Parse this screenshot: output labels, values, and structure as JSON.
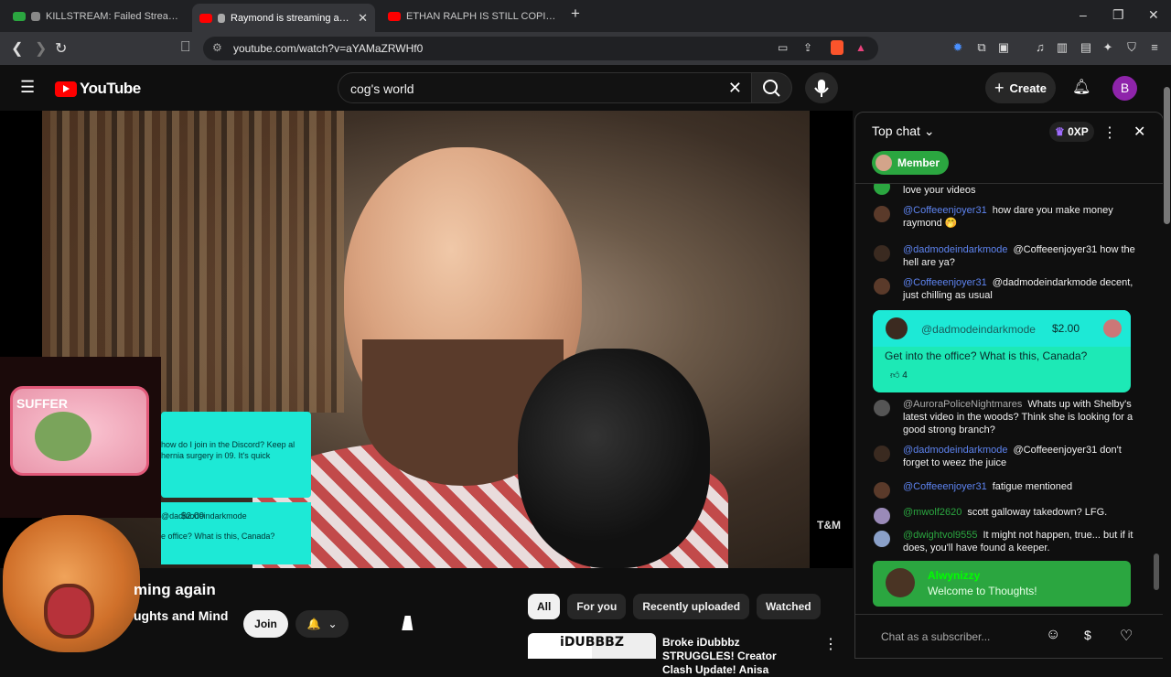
{
  "browser": {
    "tabs": [
      {
        "title": "KILLSTREAM: Failed Streamer Kyle"
      },
      {
        "title": "Raymond is streaming again"
      },
      {
        "title": "ETHAN RALPH IS STILL COPING, STILL"
      }
    ],
    "new_tab": "+",
    "url": "youtube.com/watch?v=aYAMaZRWHf0",
    "window_controls": {
      "minimize": "–",
      "maximize": "❐",
      "close": "✕"
    }
  },
  "youtube": {
    "logo_text": "YouTube",
    "search_query": "cog's world",
    "clear_icon": "✕",
    "create_label": "Create",
    "avatar_letter": "B"
  },
  "player": {
    "overlay_card_1": "how do I join in the Discord? Keep  al hernia surgery in 09. It's quick",
    "overlay_card_2_name": "@dadmodeindarkmode",
    "overlay_card_2_amount": "$2.00",
    "overlay_card_2_text": "e office? What is this, Canada?",
    "suffer_text": "SUFFER",
    "watermark": "T&M"
  },
  "video": {
    "title": "ming again",
    "channel": "ughts and Mind",
    "join_label": "Join",
    "bell_icon": "🔔",
    "dropdown_icon": "⌄"
  },
  "recommendations": {
    "chips": [
      "All",
      "For you",
      "Recently uploaded",
      "Watched"
    ],
    "selected_chip": "All",
    "first_thumb_text": "iDUBBBZ",
    "first_title": "Broke iDubbbz STRUGGLES! Creator Clash Update! Anisa",
    "more_icon": "⋮"
  },
  "chat": {
    "header": "Top chat",
    "xp": "0XP",
    "member_label": "Member",
    "messages": [
      {
        "author": "",
        "text": "love your videos"
      },
      {
        "author": "@Coffeeenjoyer31",
        "text": "how dare you make money raymond 🤭"
      },
      {
        "author": "@dadmodeindarkmode",
        "text": "@Coffeeenjoyer31 how the hell are ya?"
      },
      {
        "author": "@Coffeeenjoyer31",
        "text": "@dadmodeindarkmode decent, just chilling as usual"
      },
      {
        "author": "@AuroraPoliceNightmares",
        "text": "Whats up with Shelby's latest video in the woods? Think she is looking for a good strong branch?"
      },
      {
        "author": "@dadmodeindarkmode",
        "text": "@Coffeeenjoyer31 don't forget to weez the juice"
      },
      {
        "author": "@Coffeeenjoyer31",
        "text": "fatigue mentioned"
      },
      {
        "author": "@mwolf2620",
        "text": "scott galloway takedown? LFG."
      },
      {
        "author": "@dwightvol9555",
        "text": "It might not happen, true... but if it does, you'll have found a keeper."
      }
    ],
    "superchat": {
      "author": "@dadmodeindarkmode",
      "amount": "$2.00",
      "text": "Get into the office? What is this, Canada?",
      "likes": "4"
    },
    "welcome": {
      "name": "Alwynizzy",
      "text": "Welcome to Thoughts!"
    },
    "input_placeholder": "Chat as a subscriber...",
    "close_icon": "✕",
    "more_icon": "⋮"
  }
}
